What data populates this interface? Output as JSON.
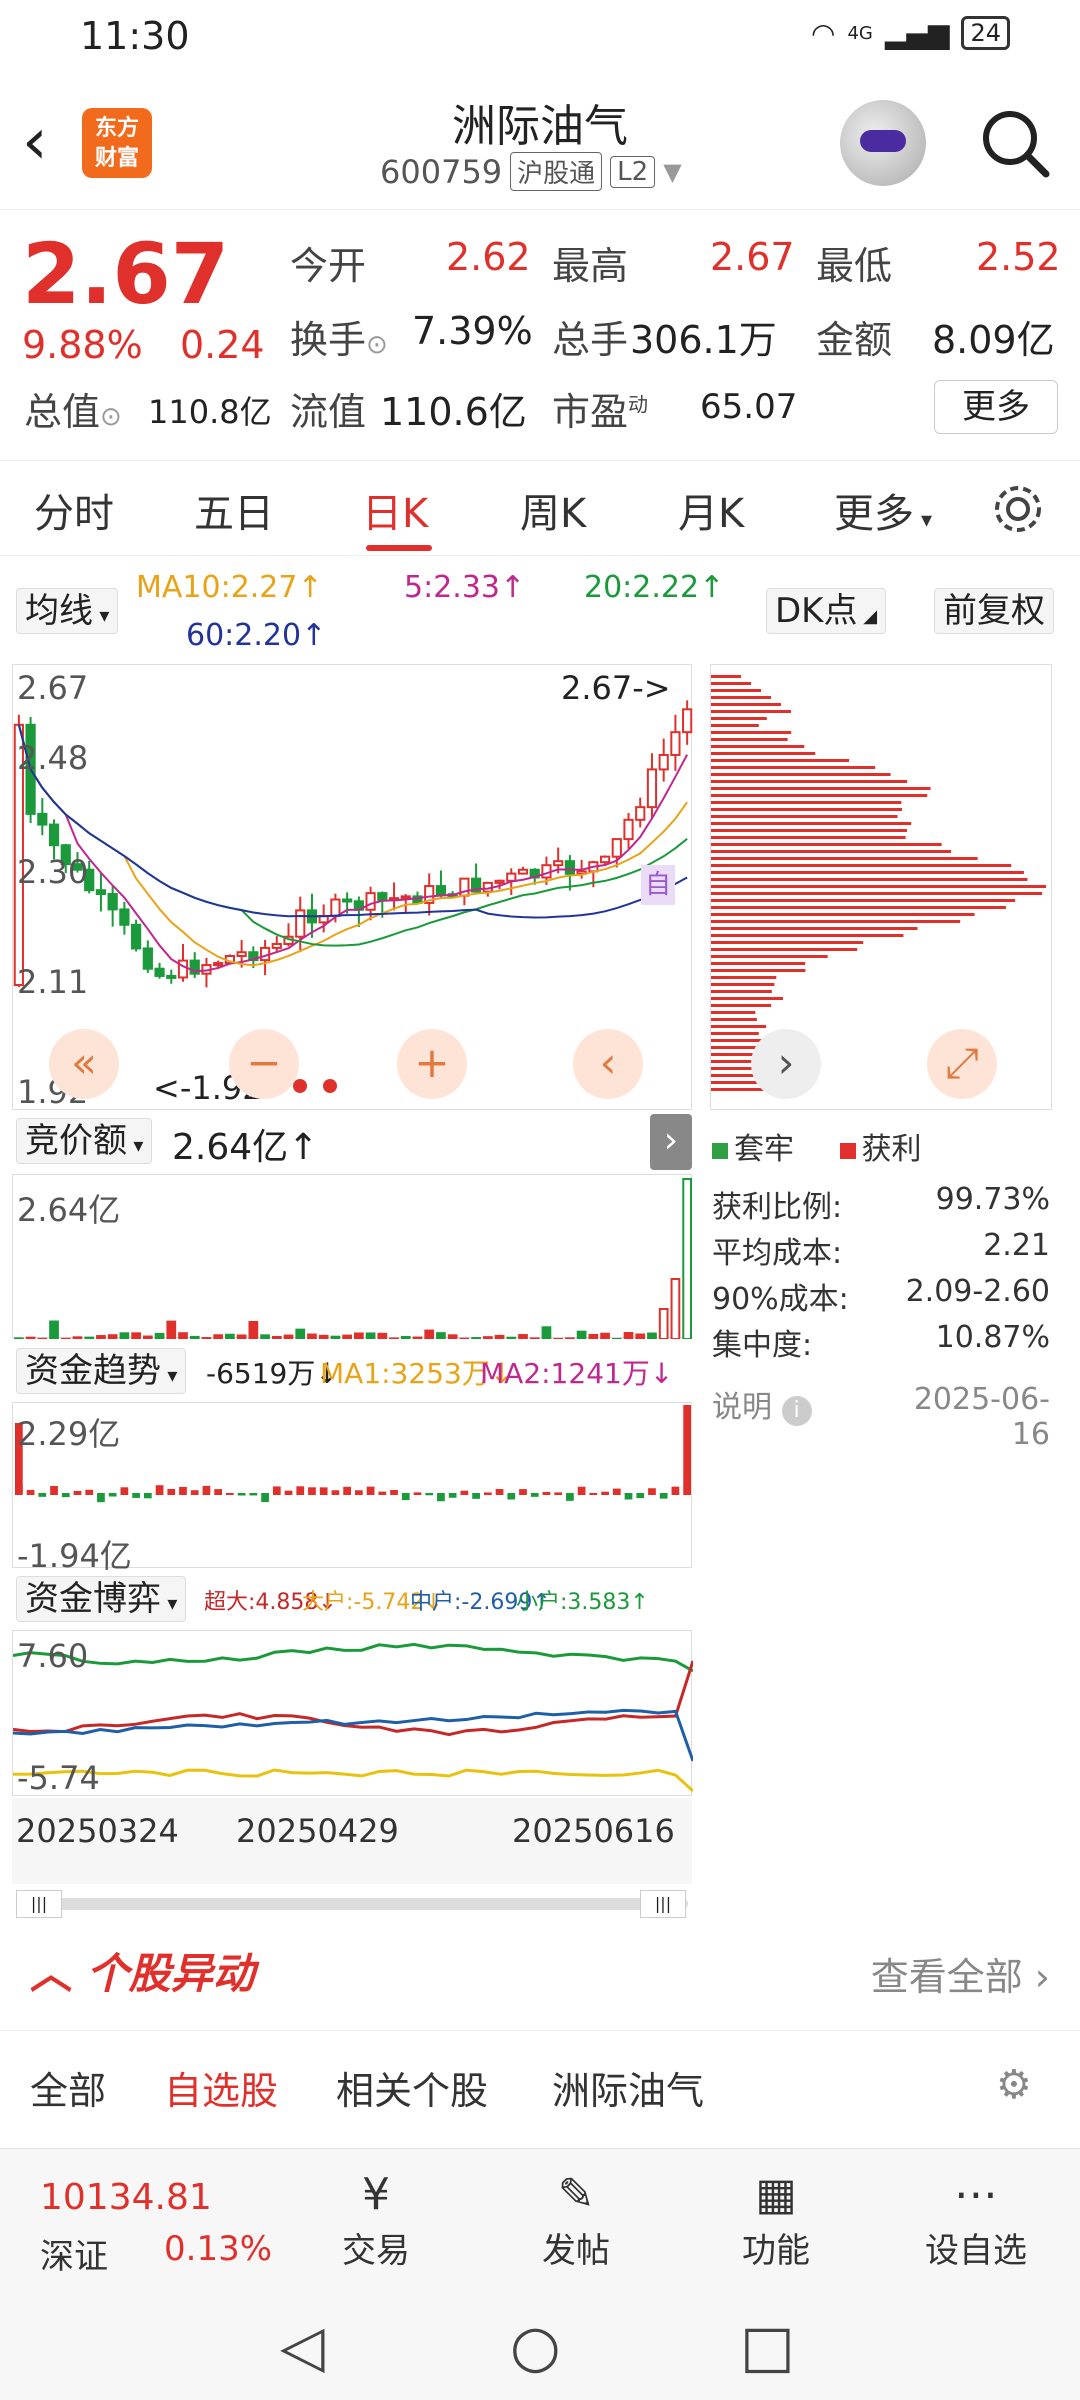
{
  "status_bar": {
    "time": "11:30",
    "network": "4G",
    "battery": "24"
  },
  "header": {
    "back_icon": "back-arrow-icon",
    "brand_line1": "东方",
    "brand_line2": "财富",
    "stock_name": "洲际油气",
    "stock_code": "600759",
    "tag_hgt": "沪股通",
    "tag_level": "L2"
  },
  "quote": {
    "price": "2.67",
    "change_pct": "9.88%",
    "change": "0.24",
    "open_label": "今开",
    "open": "2.62",
    "high_label": "最高",
    "high": "2.67",
    "low_label": "最低",
    "low": "2.52",
    "turnover_label": "换手",
    "turnover": "7.39%",
    "volume_label": "总手",
    "volume": "306.1万",
    "amount_label": "金额",
    "amount": "8.09亿",
    "total_cap_label": "总值",
    "total_cap": "110.8亿",
    "float_cap_label": "流值",
    "float_cap": "110.6亿",
    "pe_label": "市盈",
    "pe_sup": "动",
    "pe": "65.07",
    "more_label": "更多"
  },
  "tabs": [
    "分时",
    "五日",
    "日K",
    "周K",
    "月K",
    "更多"
  ],
  "indicators": {
    "ma_label": "均线",
    "ma10": "MA10:2.27↑",
    "ma5": "5:2.33↑",
    "ma20": "20:2.22↑",
    "ma60": "60:2.20↑",
    "dk_label": "DK点",
    "adjust_label": "前复权"
  },
  "kline": {
    "y_labels": [
      "2.67",
      "2.48",
      "2.30",
      "2.11",
      "1.92"
    ],
    "max_marker": "2.67->",
    "min_marker": "<-1.92",
    "self_tag": "自"
  },
  "auction": {
    "label": "竞价额",
    "value": "2.64亿↑",
    "axis_top": "2.64亿"
  },
  "capital_trend": {
    "label": "资金趋势",
    "value": "-6519万↓",
    "ma1": "MA1:3253万↓",
    "ma2": "MA2:1241万↓",
    "axis_top": "2.29亿",
    "axis_bottom": "-1.94亿"
  },
  "capital_game": {
    "label": "资金博弈",
    "super": "超大:4.858↓",
    "big": "大户:-5.742↓",
    "mid": "中户:-2.699↑",
    "small": "小户:3.583↑",
    "axis_top": "7.60",
    "axis_bottom": "-5.74"
  },
  "x_dates": [
    "20250324",
    "20250429",
    "20250616"
  ],
  "chip": {
    "legend_trapped": "套牢",
    "legend_profit": "获利",
    "profit_ratio_label": "获利比例:",
    "profit_ratio": "99.73%",
    "avg_cost_label": "平均成本:",
    "avg_cost": "2.21",
    "cost90_label": "90%成本:",
    "cost90": "2.09-2.60",
    "concentration_label": "集中度:",
    "concentration": "10.87%",
    "note_label": "说明",
    "date": "2025-06-16"
  },
  "alerts": {
    "title": "个股异动",
    "view_all": "查看全部",
    "subtabs": [
      "全部",
      "自选股",
      "相关个股",
      "洲际油气"
    ]
  },
  "bottom_nav": {
    "index_value": "10134.81",
    "index_name": "深证",
    "index_pct": "0.13%",
    "items": [
      "交易",
      "发帖",
      "功能",
      "设自选"
    ]
  },
  "colors": {
    "up": "#e0302b",
    "down": "#1a9a3a",
    "accent": "#f26a1b"
  }
}
